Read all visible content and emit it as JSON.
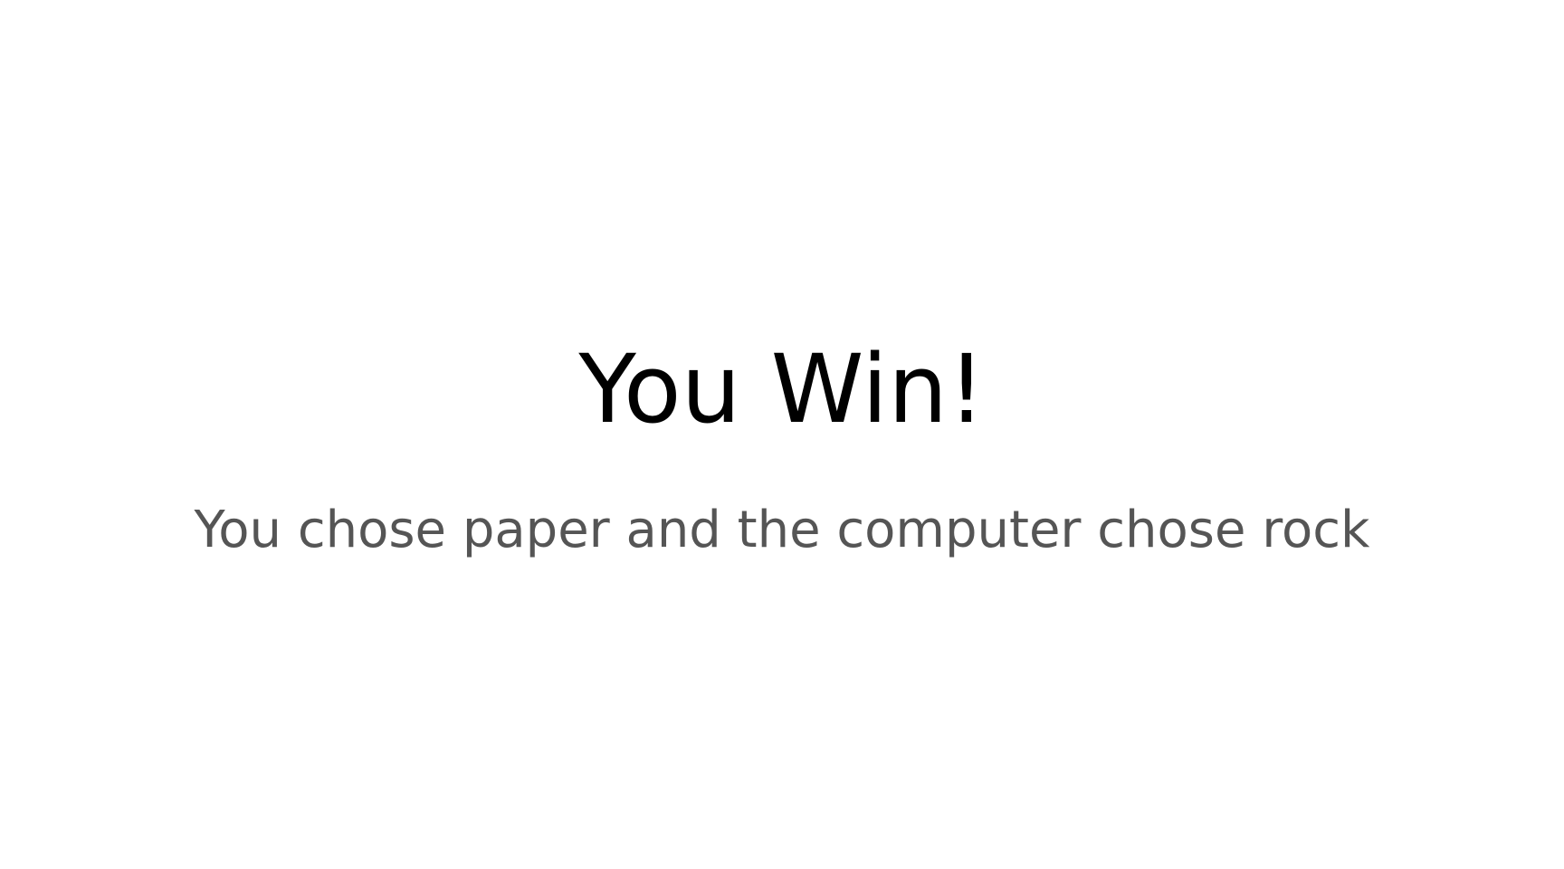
{
  "result": {
    "title": "You Win!",
    "message": "You chose paper and the computer chose rock"
  },
  "colors": {
    "title": "#000000",
    "message": "#555555",
    "background": "#ffffff"
  }
}
